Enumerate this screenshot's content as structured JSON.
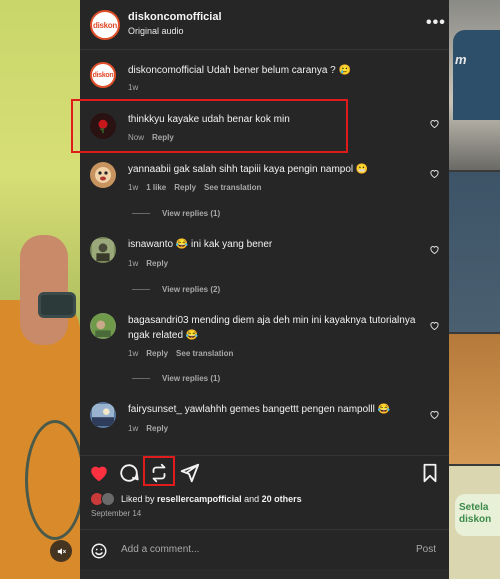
{
  "header": {
    "username": "diskoncomofficial",
    "subtitle": "Original audio",
    "avatar_text": "diskon",
    "more_icon": "more-horizontal-icon"
  },
  "comments": [
    {
      "username": "diskoncomofficial",
      "text": "Udah bener belum caranya ? 🥲",
      "time": "1w",
      "likes": "",
      "reply": "",
      "translate": "",
      "avatar_color": "#ffffff",
      "show_heart": false
    },
    {
      "username": "thinkkyu",
      "text": "kayake udah benar kok min",
      "time": "Now",
      "likes": "",
      "reply": "Reply",
      "translate": "",
      "avatar_color": "#3a1010",
      "show_heart": true,
      "view_replies": ""
    },
    {
      "username": "yannaabii",
      "text": "gak salah sihh tapiii kaya pengin nampol 😬",
      "time": "1w",
      "likes": "1 like",
      "reply": "Reply",
      "translate": "See translation",
      "avatar_color": "#c7935e",
      "show_heart": true,
      "view_replies": "View replies (1)"
    },
    {
      "username": "isnawanto",
      "text": "😂 ini kak yang bener",
      "time": "1w",
      "likes": "",
      "reply": "Reply",
      "translate": "",
      "avatar_color": "#7a8a5a",
      "show_heart": true,
      "view_replies": "View replies (2)"
    },
    {
      "username": "bagasandri03",
      "text": "mending diem aja deh min ini kayaknya tutorialnya ngak related 😂",
      "time": "1w",
      "likes": "",
      "reply": "Reply",
      "translate": "See translation",
      "avatar_color": "#7a9a5a",
      "show_heart": true,
      "view_replies": "View replies (1)"
    },
    {
      "username": "fairysunset_",
      "text": "yawlahhh gemes bangettt pengen nampolll 😂",
      "time": "1w",
      "likes": "",
      "reply": "Reply",
      "translate": "",
      "avatar_color": "#5a7aa0",
      "show_heart": true,
      "view_replies": ""
    }
  ],
  "actions": {
    "like_icon": "heart-filled-icon",
    "comment_icon": "comment-icon",
    "repost_icon": "repost-icon",
    "share_icon": "send-icon",
    "save_icon": "bookmark-icon",
    "like_color": "#ff3040"
  },
  "likes": {
    "prefix": "Liked by",
    "user": "resellercampofficial",
    "middle": "and",
    "others": "20 others"
  },
  "date": "September 14",
  "add_comment": {
    "placeholder": "Add a comment...",
    "post_label": "Post"
  },
  "background": {
    "right_top_text": "m",
    "right_bottom_text": "Setela diskon"
  },
  "highlight_color": "#e01b1b"
}
